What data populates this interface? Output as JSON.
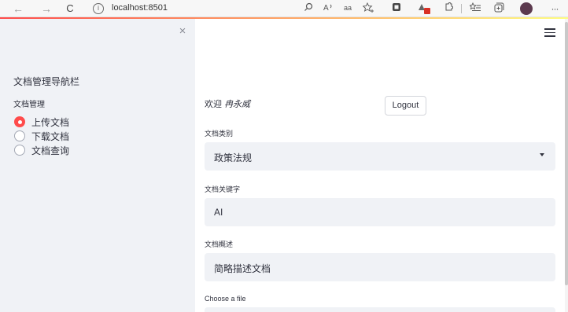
{
  "browser": {
    "back_icon": "←",
    "forward_icon": "→",
    "refresh_icon": "C",
    "info_icon": "i",
    "url": "localhost:8501",
    "toolbar_icons": [
      "search-icon",
      "read-aloud-icon",
      "translate-icon",
      "favorite-add-icon",
      "extension-icon",
      "extension-badge-icon",
      "puzzle-icon",
      "favorites-icon",
      "collections-icon",
      "profile-avatar",
      "more-icon"
    ]
  },
  "sidebar": {
    "close_icon": "×",
    "title": "文档管理导航栏",
    "radio_label": "文档管理",
    "options": [
      {
        "label": "上传文档",
        "checked": true
      },
      {
        "label": "下载文档",
        "checked": false
      },
      {
        "label": "文档查询",
        "checked": false
      }
    ]
  },
  "main": {
    "welcome_prefix": "欢迎",
    "welcome_name": "冉永威",
    "logout_label": "Logout",
    "category_label": "文档类别",
    "category_value": "政策法规",
    "keyword_label": "文档关键字",
    "keyword_value": "AI",
    "summary_label": "文档概述",
    "summary_value": "简略描述文档",
    "file_label": "Choose a file"
  },
  "colors": {
    "accent": "#ff4b4b",
    "sidebar_bg": "#f0f2f6",
    "text": "#31333f"
  }
}
